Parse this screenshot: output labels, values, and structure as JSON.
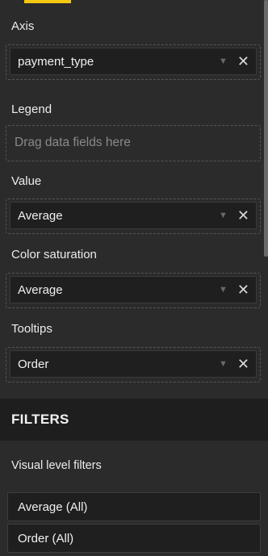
{
  "fields": {
    "axis": {
      "label": "Axis",
      "value": "payment_type"
    },
    "legend": {
      "label": "Legend",
      "placeholder": "Drag data fields here"
    },
    "value": {
      "label": "Value",
      "value": "Average"
    },
    "color_saturation": {
      "label": "Color saturation",
      "value": "Average"
    },
    "tooltips": {
      "label": "Tooltips",
      "value": "Order"
    }
  },
  "filters": {
    "title": "FILTERS",
    "visual_level_label": "Visual level filters",
    "items": [
      {
        "label": "Average (All)"
      },
      {
        "label": "Order (All)"
      }
    ]
  },
  "icons": {
    "dropdown": "chevron-down-icon",
    "remove": "close-icon"
  },
  "colors": {
    "accent": "#f2c811",
    "panel_bg": "#2b2b2b",
    "field_bg": "#1f1f1f",
    "header_bg": "#1e1e1e"
  }
}
